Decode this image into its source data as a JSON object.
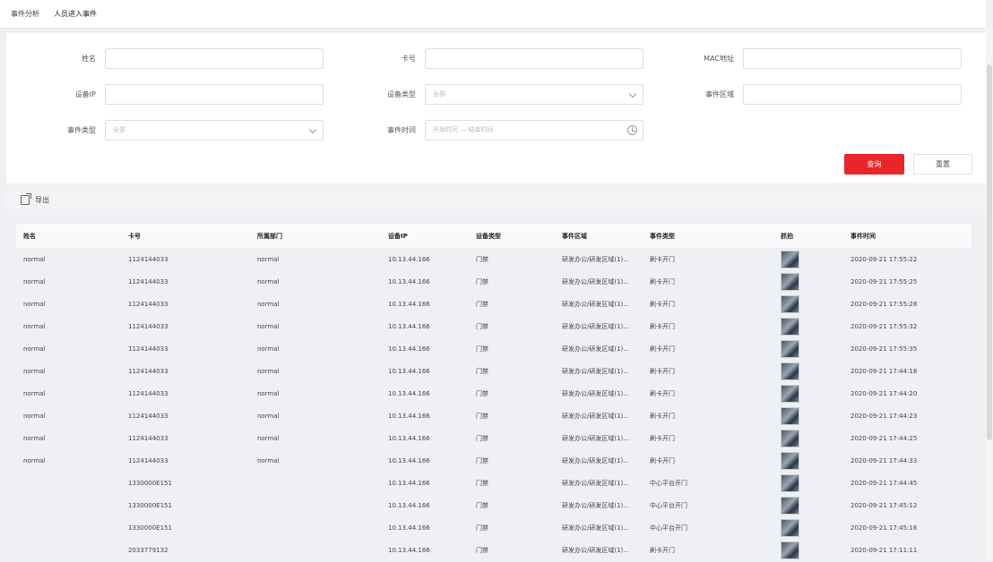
{
  "breadcrumb": [
    "事件分析",
    "人员进入事件"
  ],
  "filters": [
    {
      "label": "姓名",
      "value": "",
      "type": "text"
    },
    {
      "label": "卡号",
      "value": "",
      "type": "text"
    },
    {
      "label": "MAC地址",
      "value": "",
      "type": "text"
    },
    {
      "label": "设备IP",
      "value": "",
      "type": "text"
    },
    {
      "label": "设备类型",
      "value": "全部",
      "type": "select"
    },
    {
      "label": "事件区域",
      "value": "",
      "type": "text"
    },
    {
      "label": "事件类型",
      "value": "全部",
      "type": "select"
    },
    {
      "label": "事件时间",
      "value": "开始时间 — 结束时间",
      "type": "daterange"
    }
  ],
  "buttons": {
    "query": "查询",
    "reset": "重置"
  },
  "toolbar": {
    "export": "导出"
  },
  "table": {
    "headers": [
      "姓名",
      "卡号",
      "所属部门",
      "设备IP",
      "设备类型",
      "事件区域",
      "事件类型",
      "抓拍",
      "事件时间"
    ],
    "rows": [
      [
        "normal",
        "1124144033",
        "normal",
        "10.13.44.166",
        "门禁",
        "研发办公/研发区域(1)...",
        "刷卡开门",
        "",
        "2020-09-21 17:55:22"
      ],
      [
        "normal",
        "1124144033",
        "normal",
        "10.13.44.166",
        "门禁",
        "研发办公/研发区域(1)...",
        "刷卡开门",
        "",
        "2020-09-21 17:55:25"
      ],
      [
        "normal",
        "1124144033",
        "normal",
        "10.13.44.166",
        "门禁",
        "研发办公/研发区域(1)...",
        "刷卡开门",
        "",
        "2020-09-21 17:55:28"
      ],
      [
        "normal",
        "1124144033",
        "normal",
        "10.13.44.166",
        "门禁",
        "研发办公/研发区域(1)...",
        "刷卡开门",
        "",
        "2020-09-21 17:55:32"
      ],
      [
        "normal",
        "1124144033",
        "normal",
        "10.13.44.166",
        "门禁",
        "研发办公/研发区域(1)...",
        "刷卡开门",
        "",
        "2020-09-21 17:55:35"
      ],
      [
        "normal",
        "1124144033",
        "normal",
        "10.13.44.166",
        "门禁",
        "研发办公/研发区域(1)...",
        "刷卡开门",
        "",
        "2020-09-21 17:44:18"
      ],
      [
        "normal",
        "1124144033",
        "normal",
        "10.13.44.166",
        "门禁",
        "研发办公/研发区域(1)...",
        "刷卡开门",
        "",
        "2020-09-21 17:44:20"
      ],
      [
        "normal",
        "1124144033",
        "normal",
        "10.13.44.166",
        "门禁",
        "研发办公/研发区域(1)...",
        "刷卡开门",
        "",
        "2020-09-21 17:44:23"
      ],
      [
        "normal",
        "1124144033",
        "normal",
        "10.13.44.166",
        "门禁",
        "研发办公/研发区域(1)...",
        "刷卡开门",
        "",
        "2020-09-21 17:44:25"
      ],
      [
        "normal",
        "1124144033",
        "normal",
        "10.13.44.166",
        "门禁",
        "研发办公/研发区域(1)...",
        "刷卡开门",
        "",
        "2020-09-21 17:44:33"
      ],
      [
        "",
        "1330000E151",
        "",
        "10.13.44.166",
        "门禁",
        "研发办公/研发区域(1)...",
        "中心平台开门",
        "",
        "2020-09-21 17:44:45"
      ],
      [
        "",
        "1330000E151",
        "",
        "10.13.44.166",
        "门禁",
        "研发办公/研发区域(1)...",
        "中心平台开门",
        "",
        "2020-09-21 17:45:12"
      ],
      [
        "",
        "1330000E151",
        "",
        "10.13.44.166",
        "门禁",
        "研发办公/研发区域(1)...",
        "中心平台开门",
        "",
        "2020-09-21 17:45:16"
      ],
      [
        "",
        "2033779132",
        "",
        "10.13.44.166",
        "门禁",
        "研发办公/研发区域(1)...",
        "刷卡开门",
        "",
        "2020-09-21 17:11:11"
      ]
    ]
  }
}
